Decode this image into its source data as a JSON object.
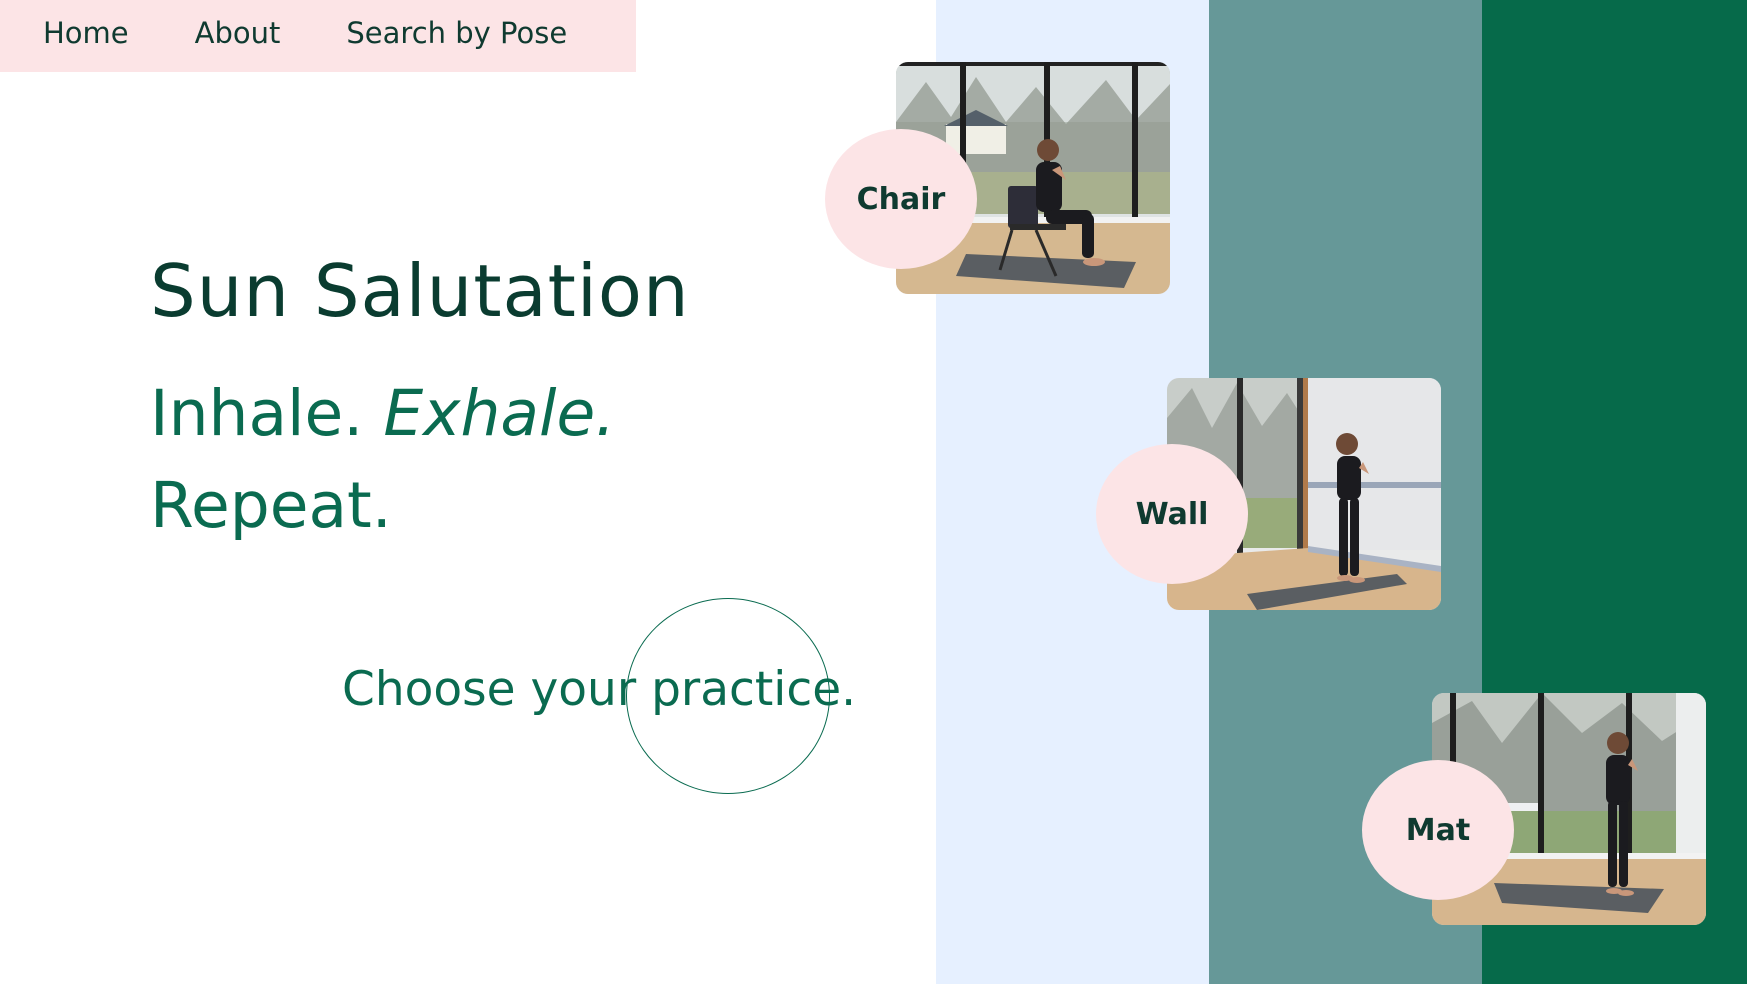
{
  "nav": {
    "items": [
      {
        "label": "Home"
      },
      {
        "label": "About"
      },
      {
        "label": "Search by Pose"
      }
    ]
  },
  "hero": {
    "title": "Sun Salutation",
    "tagline_part1": "Inhale.",
    "tagline_part2": "Exhale.",
    "tagline_part3": "Repeat."
  },
  "cta": {
    "text": "Choose your practice."
  },
  "practices": [
    {
      "label": "Chair",
      "image": "woman-seated-on-chair-photo"
    },
    {
      "label": "Wall",
      "image": "woman-standing-near-wall-photo"
    },
    {
      "label": "Mat",
      "image": "woman-standing-on-mat-photo"
    }
  ],
  "colors": {
    "nav_bg": "#fce4e6",
    "badge_bg": "#fce4e6",
    "stripe_light": "#e6f0ff",
    "stripe_teal": "#669898",
    "stripe_green": "#066a4a",
    "title_text": "#0a3c30",
    "accent_text": "#0a6b50"
  }
}
